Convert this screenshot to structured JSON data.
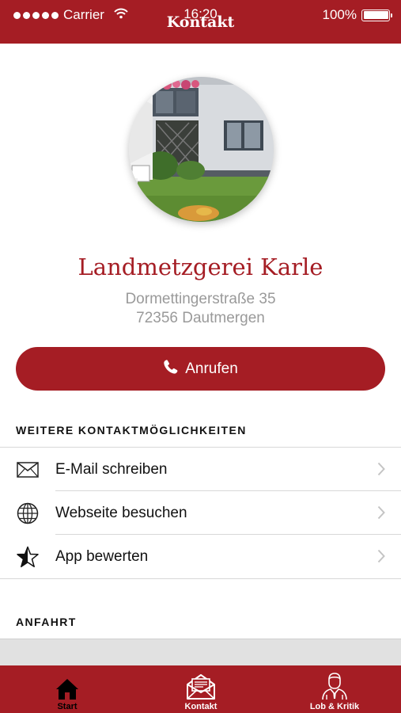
{
  "status": {
    "carrier": "Carrier",
    "time": "16:20",
    "battery": "100%"
  },
  "nav": {
    "title": "Kontakt"
  },
  "business": {
    "name": "Landmetzgerei Karle",
    "street": "Dormettingerstraße 35",
    "city": "72356 Dautmergen"
  },
  "call_button": {
    "label": "Anrufen"
  },
  "contact_section": {
    "title": "WEITERE KONTAKTMÖGLICHKEITEN",
    "items": [
      {
        "label": "E-Mail schreiben",
        "icon": "envelope-icon"
      },
      {
        "label": "Webseite besuchen",
        "icon": "globe-icon"
      },
      {
        "label": "App bewerten",
        "icon": "star-icon"
      }
    ]
  },
  "directions_section": {
    "title": "ANFAHRT"
  },
  "tabs": [
    {
      "label": "Start",
      "icon": "home-icon",
      "active": true
    },
    {
      "label": "Kontakt",
      "icon": "mail-envelope-icon",
      "active": false
    },
    {
      "label": "Lob & Kritik",
      "icon": "person-icon",
      "active": false
    }
  ],
  "colors": {
    "brand": "#a51d24",
    "active_tab": "#000000",
    "inactive_tab": "#ffffff",
    "muted_text": "#9a9a9a"
  }
}
